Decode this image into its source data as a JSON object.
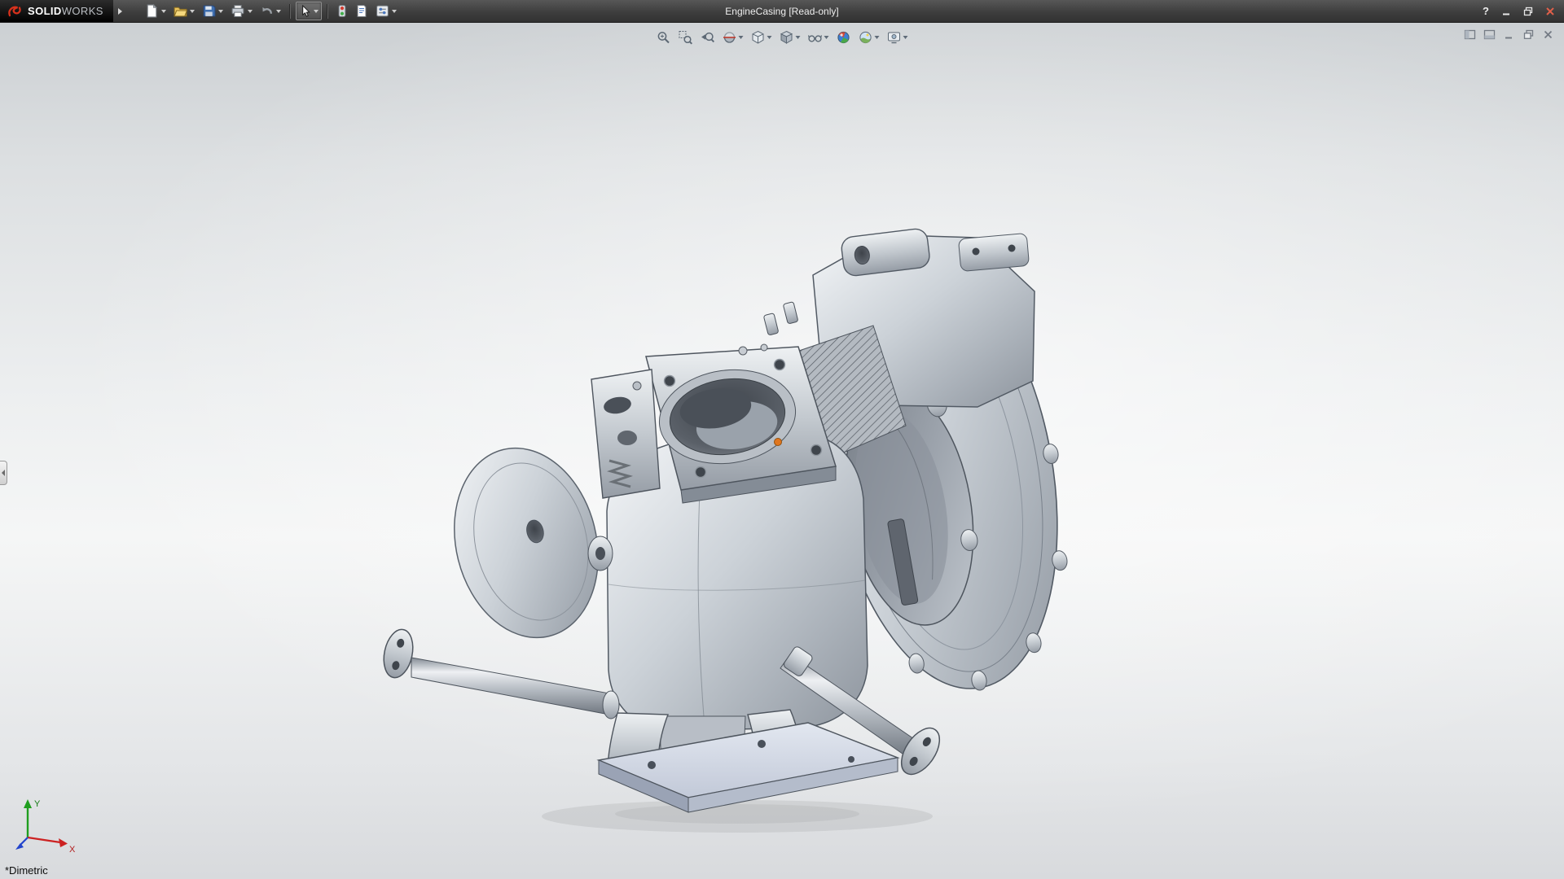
{
  "titlebar": {
    "brand": {
      "name_bold": "SOLID",
      "name_light": "WORKS"
    },
    "title": "EngineCasing [Read-only]",
    "help_label": "?",
    "window_controls": [
      {
        "name": "minimize"
      },
      {
        "name": "maximize-restore"
      },
      {
        "name": "close"
      }
    ]
  },
  "main_toolbar": {
    "items": [
      {
        "name": "new-document",
        "dropdown": true
      },
      {
        "name": "open",
        "dropdown": true
      },
      {
        "name": "save",
        "dropdown": true
      },
      {
        "name": "print",
        "dropdown": true
      },
      {
        "name": "undo",
        "dropdown": true,
        "disabled": true
      },
      {
        "name": "select",
        "dropdown": true,
        "active": true
      },
      {
        "name": "rebuild",
        "dropdown": false
      },
      {
        "name": "file-properties",
        "dropdown": false
      },
      {
        "name": "options",
        "dropdown": true
      }
    ]
  },
  "heads_up_toolbar": {
    "items": [
      {
        "name": "zoom-to-fit",
        "dropdown": false
      },
      {
        "name": "zoom-to-area",
        "dropdown": false
      },
      {
        "name": "previous-view",
        "dropdown": false
      },
      {
        "name": "section-view",
        "dropdown": true
      },
      {
        "name": "view-orientation",
        "dropdown": true
      },
      {
        "name": "display-style",
        "dropdown": true
      },
      {
        "name": "hide-show-items",
        "dropdown": true
      },
      {
        "name": "edit-appearance",
        "dropdown": false
      },
      {
        "name": "apply-scene",
        "dropdown": true
      },
      {
        "name": "view-settings",
        "dropdown": true
      }
    ]
  },
  "document_controls": [
    {
      "name": "pane-left"
    },
    {
      "name": "pane-bottom"
    },
    {
      "name": "doc-minimize"
    },
    {
      "name": "doc-restore"
    },
    {
      "name": "doc-close"
    }
  ],
  "viewport": {
    "orientation_label": "*Dimetric",
    "triad": {
      "x_label": "X",
      "y_label": "Y"
    }
  },
  "colors": {
    "titlebar_bg": "#3e3e3e",
    "viewport_top": "#ccd0d3",
    "viewport_bottom": "#d8dadd",
    "highlight_orange": "#e0761e",
    "axis_x": "#cc2222",
    "axis_y": "#1f9e1f",
    "axis_z": "#2244cc",
    "close_red": "#e2604a"
  }
}
